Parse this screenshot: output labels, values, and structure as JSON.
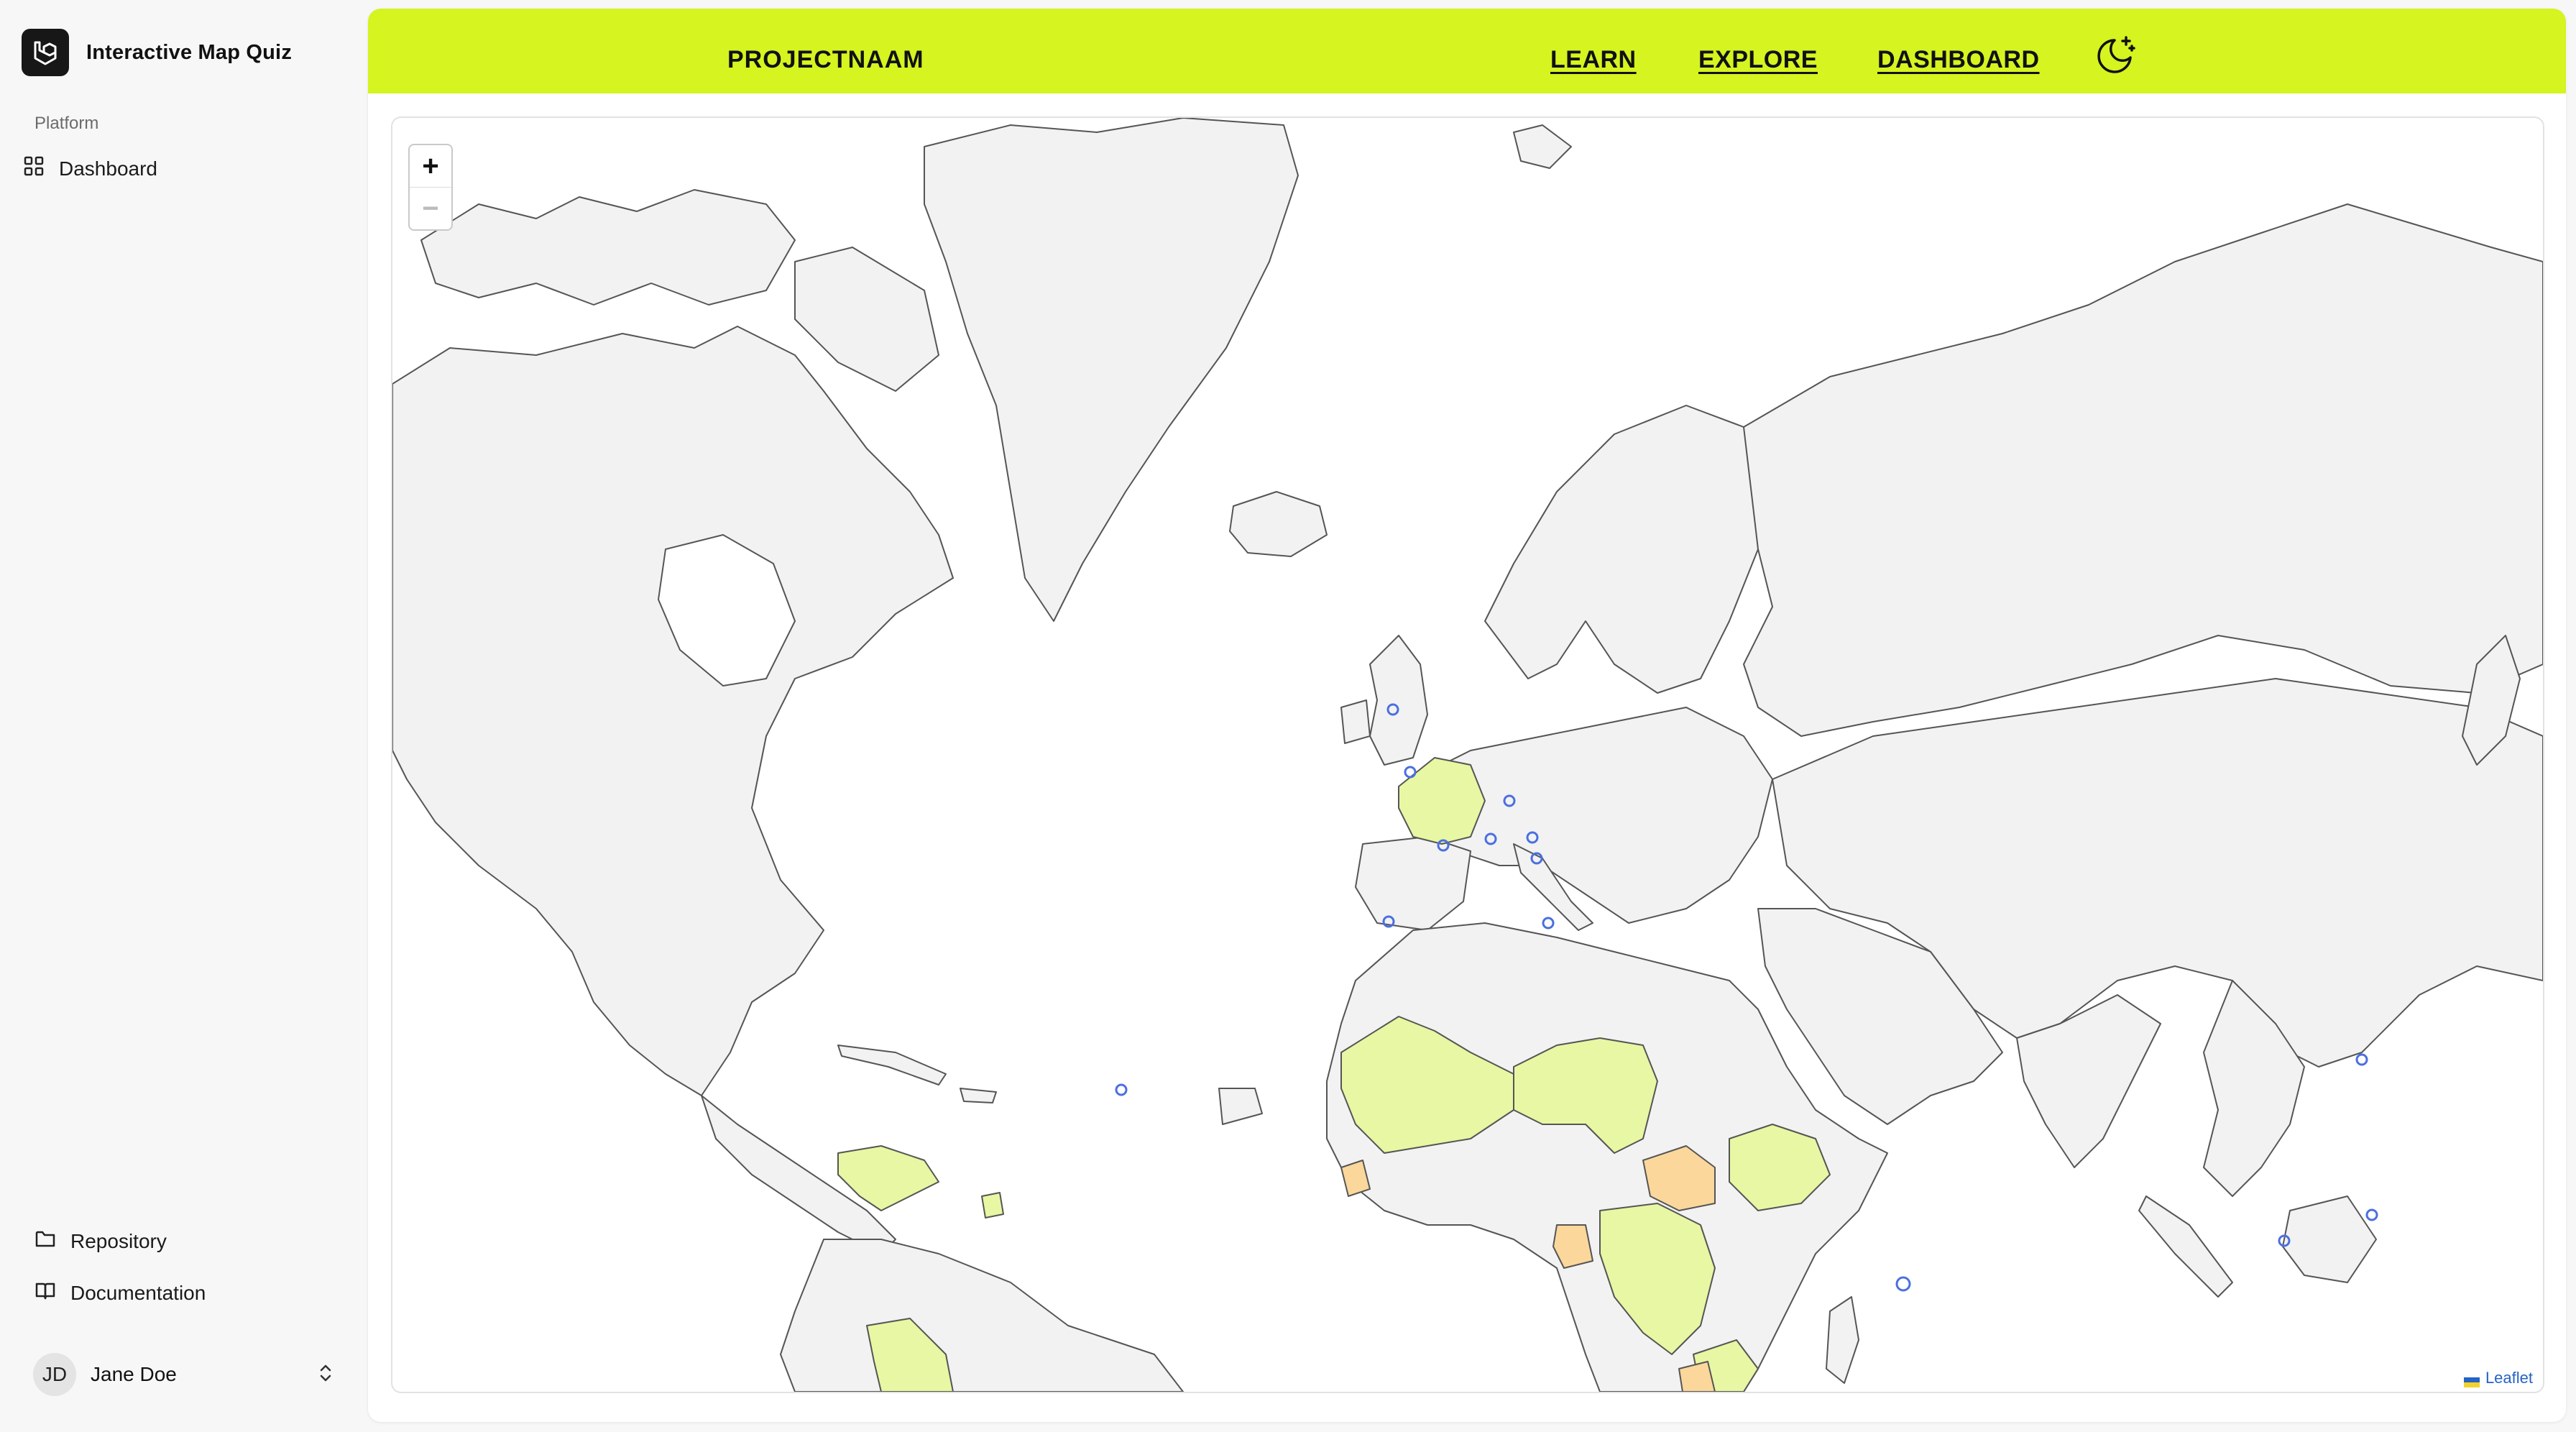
{
  "app": {
    "title": "Interactive Map Quiz"
  },
  "sidebar": {
    "group_label": "Platform",
    "items": [
      {
        "label": "Dashboard",
        "icon": "grid-icon"
      }
    ],
    "footer_items": [
      {
        "label": "Repository",
        "icon": "folder-icon"
      },
      {
        "label": "Documentation",
        "icon": "book-icon"
      }
    ],
    "user": {
      "initials": "JD",
      "name": "Jane Doe"
    }
  },
  "header": {
    "project": "PROJECTNAAM",
    "nav": [
      {
        "label": "LEARN"
      },
      {
        "label": "EXPLORE"
      },
      {
        "label": "DASHBOARD"
      }
    ],
    "theme_icon": "moon-sparkle-icon",
    "accent_color": "#d5f420"
  },
  "map": {
    "attribution": "Leaflet",
    "zoom_in": "+",
    "zoom_out": "−",
    "colors": {
      "land": "#f2f2f2",
      "border": "#555555",
      "highlight_green": "#e7f7a3",
      "highlight_orange": "#fbd79c",
      "marker": "#4b6fe0"
    }
  }
}
